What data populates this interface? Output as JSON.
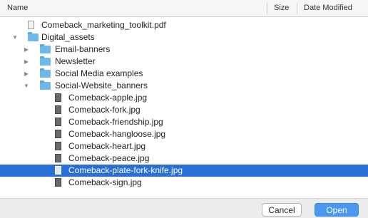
{
  "columns": {
    "name": "Name",
    "size": "Size",
    "date_modified": "Date Modified"
  },
  "rows": [
    {
      "label": "Comeback_marketing_toolkit.pdf",
      "kind": "file"
    },
    {
      "label": "Digital_assets",
      "kind": "folder",
      "expanded": true
    },
    {
      "label": "Email-banners",
      "kind": "folder",
      "expanded": false
    },
    {
      "label": "Newsletter",
      "kind": "folder",
      "expanded": false
    },
    {
      "label": "Social Media examples",
      "kind": "folder",
      "expanded": false
    },
    {
      "label": "Social-Website_banners",
      "kind": "folder",
      "expanded": true
    },
    {
      "label": "Comeback-apple.jpg",
      "kind": "image"
    },
    {
      "label": "Comeback-fork.jpg",
      "kind": "image"
    },
    {
      "label": "Comeback-friendship.jpg",
      "kind": "image"
    },
    {
      "label": "Comeback-hangloose.jpg",
      "kind": "image"
    },
    {
      "label": "Comeback-heart.jpg",
      "kind": "image"
    },
    {
      "label": "Comeback-peace.jpg",
      "kind": "image"
    },
    {
      "label": "Comeback-plate-fork-knife.jpg",
      "kind": "image",
      "selected": true
    },
    {
      "label": "Comeback-sign.jpg",
      "kind": "image"
    }
  ],
  "buttons": {
    "cancel": "Cancel",
    "open": "Open"
  },
  "colors": {
    "selection": "#2a6fd6",
    "open_button": "#4a97f0",
    "folder": "#6fb8ea"
  }
}
